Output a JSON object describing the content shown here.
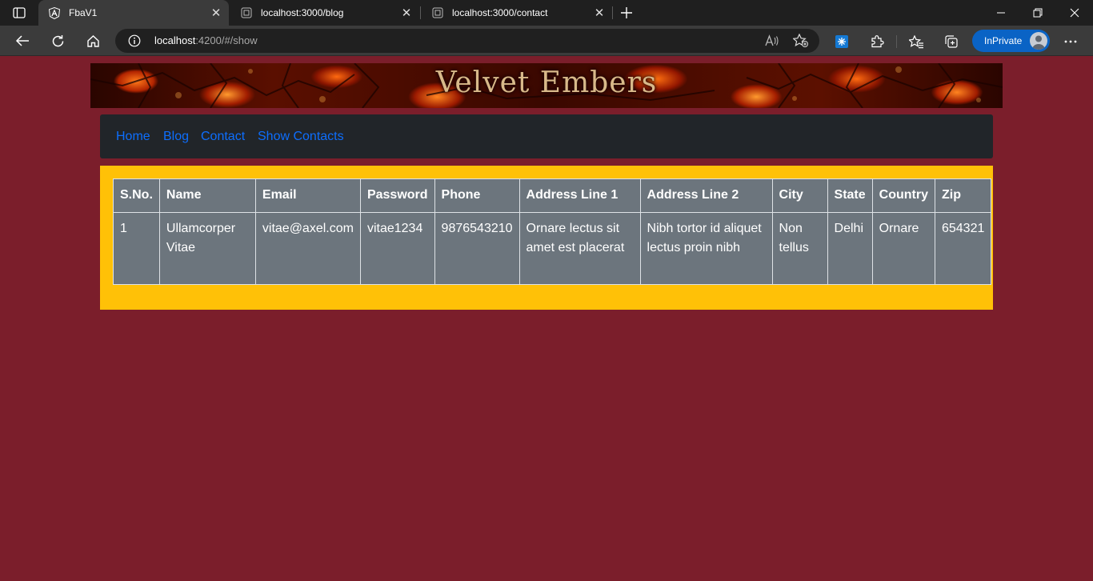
{
  "browser": {
    "tabs": [
      {
        "title": "FbaV1",
        "active": true,
        "favicon": "angular-icon"
      },
      {
        "title": "localhost:3000/blog",
        "active": false,
        "favicon": "page-icon"
      },
      {
        "title": "localhost:3000/contact",
        "active": false,
        "favicon": "page-icon"
      }
    ],
    "address": {
      "host": "localhost",
      "rest": ":4200/#/show"
    },
    "inprivate_label": "InPrivate",
    "accent": "#0a63c5"
  },
  "page": {
    "banner_title": "Velvet Embers",
    "nav": [
      "Home",
      "Blog",
      "Contact",
      "Show Contacts"
    ],
    "table": {
      "headers": [
        "S.No.",
        "Name",
        "Email",
        "Password",
        "Phone",
        "Address Line 1",
        "Address Line 2",
        "City",
        "State",
        "Country",
        "Zip"
      ],
      "rows": [
        [
          "1",
          "Ullamcorper Vitae",
          "vitae@axel.com",
          "vitae1234",
          "9876543210",
          "Ornare lectus sit amet est placerat",
          "Nibh tortor id aliquet lectus proin nibh",
          "Non tellus",
          "Delhi",
          "Ornare",
          "654321"
        ]
      ]
    },
    "colors": {
      "background": "#7b1e2b",
      "navbar": "#212529",
      "content": "#ffc107",
      "table": "#6c757d",
      "link": "#0d6efd"
    }
  }
}
